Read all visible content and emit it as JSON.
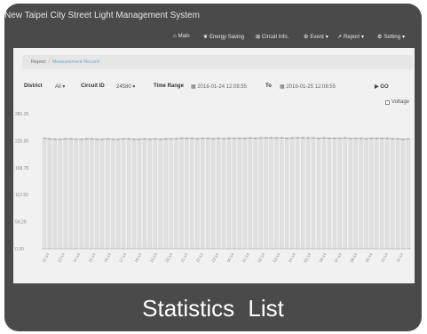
{
  "app": {
    "title": "New Taipei City Street Light Management System"
  },
  "nav": {
    "main": "Main",
    "energy": "Energy Saving",
    "circuit": "Circuit Info.",
    "event": "Event",
    "report": "Report",
    "setting": "Setting"
  },
  "breadcrumb": {
    "home": "Report",
    "current": "Measurement Record"
  },
  "filters": {
    "district_label": "District",
    "district_value": "All",
    "circuit_label": "Circuit ID",
    "circuit_value": "24580",
    "time_label": "Time Range",
    "time_start": "2016-01-24 12:08:55",
    "to_label": "To",
    "time_end": "2016-01-25 12:08:55",
    "go_label": "GO"
  },
  "caption": "Statistics List",
  "chart_data": {
    "type": "line",
    "legend": [
      "Voltage"
    ],
    "series": [
      {
        "name": "Voltage",
        "values": [
          230,
          229,
          228,
          228,
          229,
          229,
          228,
          228,
          229,
          229,
          228,
          228,
          229,
          228,
          228,
          229,
          229,
          228,
          228,
          229,
          228,
          229,
          228,
          229,
          229,
          229,
          230,
          230,
          230,
          229,
          230,
          230,
          229,
          230,
          229,
          230,
          230,
          230,
          230,
          231,
          230,
          231,
          231,
          231,
          231,
          231,
          230,
          231,
          231,
          231,
          231,
          231,
          230,
          231,
          230,
          230,
          230,
          231,
          230,
          230,
          230,
          229,
          230,
          230,
          230,
          230,
          229,
          229,
          228,
          229
        ]
      }
    ],
    "ylim": [
      0,
      281.25
    ],
    "yticks": [
      "281.25",
      "225.00",
      "168.75",
      "112.50",
      "56.25",
      "0.00"
    ],
    "xticks": [
      "12:14",
      "13:14",
      "14:14",
      "15:14",
      "16:14",
      "17:14",
      "18:14",
      "19:14",
      "20:14",
      "21:14",
      "22:14",
      "23:14",
      "00:14",
      "01:14",
      "02:14",
      "03:14",
      "04:14",
      "05:14",
      "06:14",
      "07:14",
      "08:14",
      "09:14",
      "10:14",
      "11:14"
    ],
    "colors": {
      "bar": "#e0e0e0",
      "line": "#aaaaaa",
      "axis": "#999999"
    }
  }
}
